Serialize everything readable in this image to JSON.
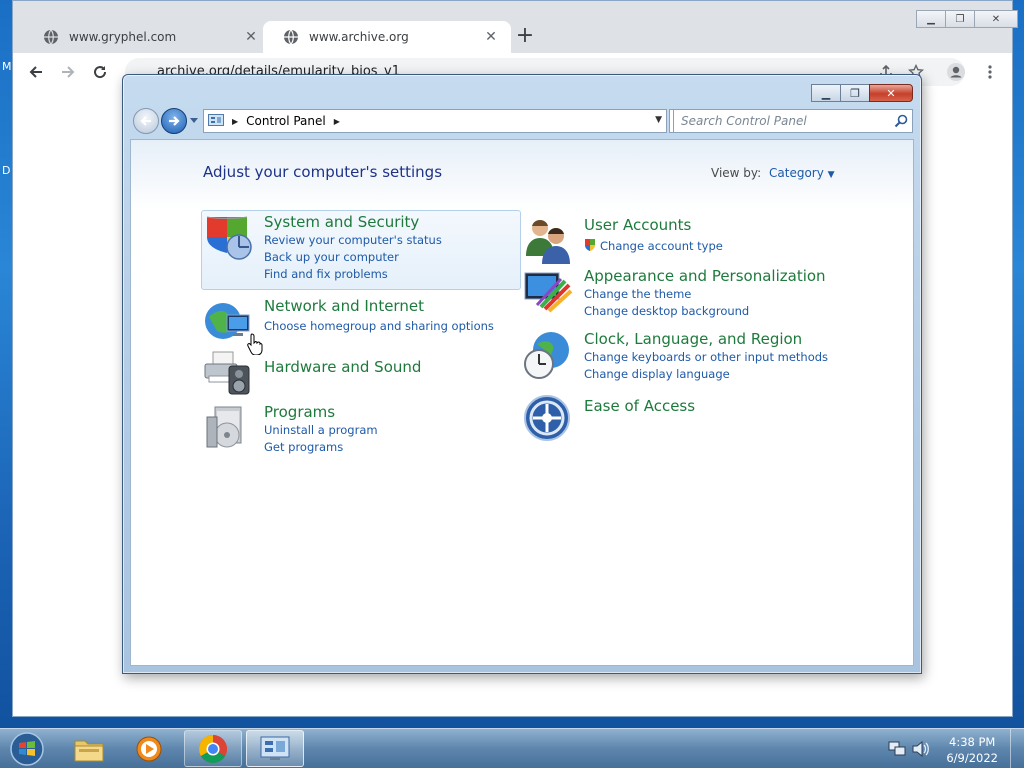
{
  "desktop": {
    "frag_left": "M",
    "frag_left2": "D"
  },
  "chrome": {
    "tabs": [
      {
        "title": "www.gryphel.com"
      },
      {
        "title": "www.archive.org"
      }
    ],
    "tab_close": "✕",
    "new_tab": "+",
    "url": "archive.org/details/emularity_bios_v1"
  },
  "control_panel": {
    "breadcrumb": "Control Panel",
    "search_placeholder": "Search Control Panel",
    "heading": "Adjust your computer's settings",
    "view_by_label": "View by:",
    "view_by_value": "Category",
    "categories": {
      "system": {
        "title": "System and Security",
        "links": [
          "Review your computer's status",
          "Back up your computer",
          "Find and fix problems"
        ]
      },
      "network": {
        "title": "Network and Internet",
        "links": [
          "Choose homegroup and sharing options"
        ]
      },
      "hardware": {
        "title": "Hardware and Sound"
      },
      "programs": {
        "title": "Programs",
        "links": [
          "Uninstall a program",
          "Get programs"
        ]
      },
      "users": {
        "title": "User Accounts",
        "links": [
          "Change account type"
        ]
      },
      "appearance": {
        "title": "Appearance and Personalization",
        "links": [
          "Change the theme",
          "Change desktop background"
        ]
      },
      "clock": {
        "title": "Clock, Language, and Region",
        "links": [
          "Change keyboards or other input methods",
          "Change display language"
        ]
      },
      "ease": {
        "title": "Ease of Access"
      }
    }
  },
  "taskbar": {
    "time": "4:38 PM",
    "date": "6/9/2022"
  },
  "icons": [
    "globe-icon",
    "back-arrow-icon",
    "forward-arrow-icon",
    "reload-icon",
    "share-icon",
    "star-icon",
    "profile-icon",
    "more-icon",
    "search-icon",
    "refresh-icon",
    "shield-icon",
    "network-icon",
    "printer-icon",
    "programs-icon",
    "users-icon",
    "appearance-icon",
    "clock-globe-icon",
    "ease-of-access-icon",
    "folder-icon",
    "media-player-icon",
    "chrome-icon",
    "control-panel-icon",
    "network-tray-icon",
    "volume-icon",
    "windows-start-icon",
    "hand-cursor-icon"
  ]
}
